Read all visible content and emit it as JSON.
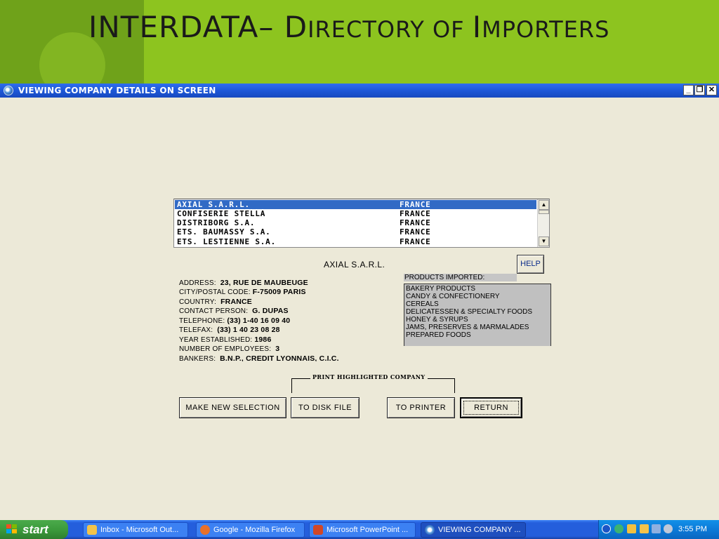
{
  "banner": {
    "title_part1": "INTERDATA",
    "title_part2": "– D",
    "title_part3": "IRECTORY OF ",
    "title_part4": "I",
    "title_part5": "MPORTERS"
  },
  "window": {
    "title": "VIEWING COMPANY DETAILS ON SCREEN",
    "minimize": "_",
    "maximize": "❐",
    "close": "✕"
  },
  "companies": [
    {
      "name": "AXIAL S.A.R.L.",
      "country": "FRANCE"
    },
    {
      "name": "CONFISERIE STELLA",
      "country": "FRANCE"
    },
    {
      "name": "DISTRIBORG S.A.",
      "country": "FRANCE"
    },
    {
      "name": "ETS. BAUMASSY S.A.",
      "country": "FRANCE"
    },
    {
      "name": "ETS. LESTIENNE S.A.",
      "country": "FRANCE"
    }
  ],
  "selected_company": "AXIAL S.A.R.L.",
  "help_label": "HELP",
  "details": [
    {
      "label": "ADDRESS:",
      "value": "23, RUE DE MAUBEUGE"
    },
    {
      "label": "CITY/POSTAL CODE:",
      "value": "F-75009 PARIS"
    },
    {
      "label": "COUNTRY:",
      "value": "FRANCE"
    },
    {
      "label": "CONTACT PERSON:",
      "value": "G. DUPAS"
    },
    {
      "label": "TELEPHONE:",
      "value": "(33) 1-40 16 09 40"
    },
    {
      "label": "TELEFAX:",
      "value": "(33) 1 40 23 08 28"
    },
    {
      "label": "YEAR ESTABLISHED:",
      "value": "1986"
    },
    {
      "label": "NUMBER OF EMPLOYEES:",
      "value": "3"
    },
    {
      "label": "BANKERS:",
      "value": "B.N.P., CREDIT LYONNAIS, C.I.C."
    }
  ],
  "products_label": "PRODUCTS IMPORTED:",
  "products": [
    "BAKERY PRODUCTS",
    "CANDY & CONFECTIONERY",
    "CEREALS",
    "DELICATESSEN & SPECIALTY FOODS",
    "HONEY & SYRUPS",
    "JAMS, PRESERVES & MARMALADES",
    "PREPARED FOODS"
  ],
  "print_group_label": "PRINT HIGHLIGHTED COMPANY",
  "buttons": {
    "new_selection": "MAKE NEW SELECTION",
    "disk_file": "TO DISK FILE",
    "printer": "TO PRINTER",
    "return": "RETURN"
  },
  "taskbar": {
    "start": "start",
    "tasks": [
      {
        "label": "Inbox - Microsoft Out...",
        "icon": "outlook-icon"
      },
      {
        "label": "Google - Mozilla Firefox",
        "icon": "firefox-icon"
      },
      {
        "label": "Microsoft PowerPoint ...",
        "icon": "powerpoint-icon"
      },
      {
        "label": "VIEWING COMPANY ...",
        "icon": "app-globe-icon"
      }
    ],
    "clock": "3:55 PM"
  }
}
